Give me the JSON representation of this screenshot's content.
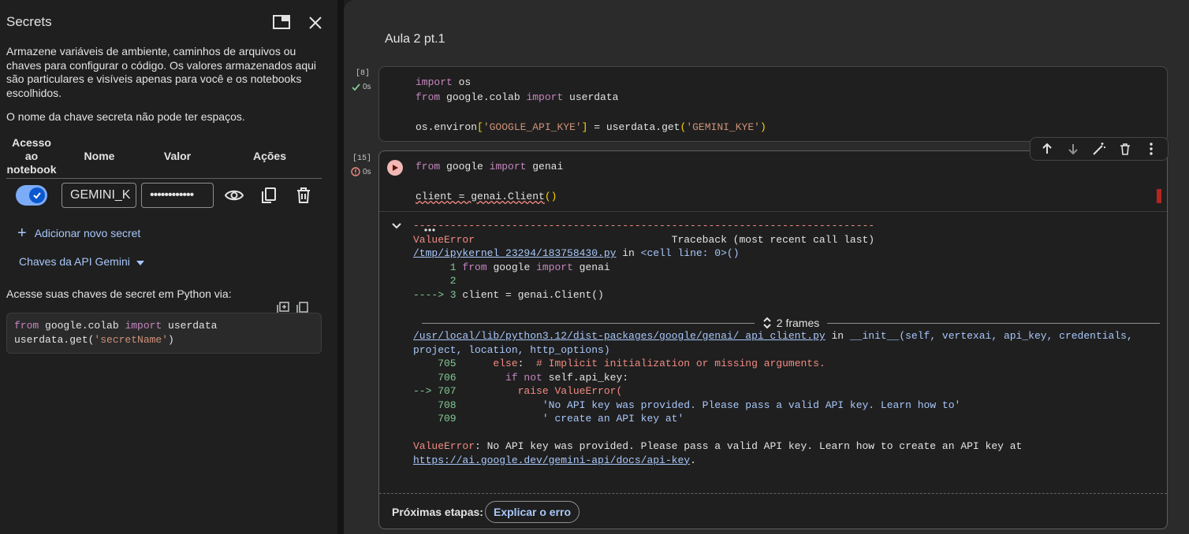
{
  "sidebar": {
    "title": "Secrets",
    "description": "Armazene variáveis de ambiente, caminhos de arquivos ou chaves para configurar o código. Os valores armazenados aqui são particulares e visíveis apenas para você e os notebooks escolhidos.",
    "rule": "O nome da chave secreta não pode ter espaços.",
    "table": {
      "col_access": "Acesso ao notebook",
      "col_name": "Nome",
      "col_value": "Valor",
      "col_actions": "Ações"
    },
    "secret": {
      "name": "GEMINI_K",
      "value": "••••••••••••",
      "enabled": true
    },
    "add_secret": "Adicionar novo secret",
    "gemini_keys": "Chaves da API Gemini",
    "access_text": "Acesse suas chaves de secret em Python via:",
    "snippet": {
      "l1_kw1": "from",
      "l1_mod": " google.colab ",
      "l1_kw2": "import",
      "l1_name": " userdata",
      "l2_a": "userdata.get(",
      "l2_str": "'secretName'",
      "l2_b": ")"
    }
  },
  "notebook": {
    "title": "Aula 2 pt.1",
    "cell1": {
      "count": "[8]",
      "time": "0s",
      "l1_kw": "import",
      "l1_rest": " os",
      "l2_kw1": "from",
      "l2_mid": " google.colab ",
      "l2_kw2": "import",
      "l2_rest": " userdata",
      "l4_a": "os.environ",
      "l4_b1": "[",
      "l4_s1": "'GOOGLE_API_KYE'",
      "l4_b2": "]",
      "l4_c": " = userdata.get",
      "l4_p1": "(",
      "l4_s2": "'GEMINI_KYE'",
      "l4_p2": ")"
    },
    "cell2": {
      "count": "[15]",
      "time": "0s",
      "l1_kw1": "from",
      "l1_mid": " google ",
      "l1_kw2": "import",
      "l1_rest": " genai",
      "l3_a": "client = genai.Client",
      "l3_p": "()",
      "output": {
        "dashes": "---------------------------------------------------------------------------",
        "err_name": "ValueError",
        "traceback_header": "                                Traceback (most recent call last)",
        "path1": "/tmp/ipykernel_23294/183758430.py",
        "in1": " in ",
        "loc1": "<cell line: 0>()",
        "t1_num": "      1 ",
        "t1_kw1": "from",
        "t1_mid": " google ",
        "t1_kw2": "import",
        "t1_rest": " genai",
        "t2_num": "      2",
        "t3_arrow": "----> 3 ",
        "t3_code": "client = genai.Client()",
        "frames": "2 frames",
        "path2": "/usr/local/lib/python3.12/dist-packages/google/genai/_api_client.py",
        "in2": " in ",
        "loc2": "__init__(self, vertexai, api_key, credentials,",
        "loc2b": "project, location, http_options)",
        "l705_num": "    705 ",
        "l705_kw": "     else",
        "l705_rest": ":  ",
        "l705_cmt": "# Implicit initialization or missing arguments.",
        "l706_num": "    706 ",
        "l706_kw": "       if not",
        "l706_rest": " self.api_key:",
        "l707_arrow": "--> 707 ",
        "l707_kw": "         raise",
        "l707_rest": " ValueError(",
        "l708_num": "    708 ",
        "l708_str": "             'No API key was provided. Please pass a valid API key. Learn how to'",
        "l709_num": "    709 ",
        "l709_str": "             ' create an API key at'",
        "final_err": "ValueError",
        "final_msg": ": No API key was provided. Please pass a valid API key. Learn how to create an API key at",
        "final_url": "https://ai.google.dev/gemini-api/docs/api-key",
        "final_dot": "."
      },
      "next_steps": "Próximas etapas:",
      "explain_btn": "Explicar o erro"
    }
  },
  "colors": {
    "accent": "#a8c7fa",
    "error": "#f28b82",
    "keyword": "#c586c0",
    "string": "#ce9178"
  }
}
